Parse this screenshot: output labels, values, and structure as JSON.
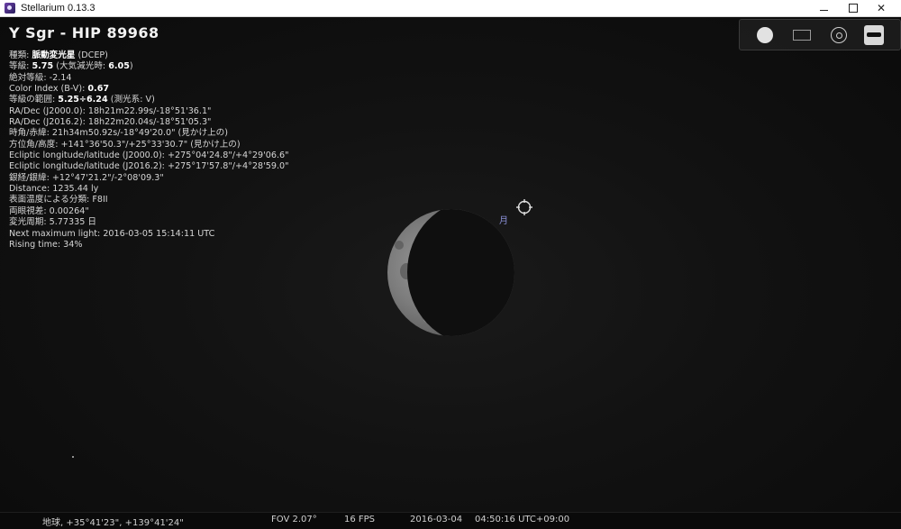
{
  "window": {
    "title": "Stellarium 0.13.3",
    "minimize_glyph": "—",
    "close_glyph": "✕"
  },
  "object": {
    "name": "Y Sgr - HIP 89968",
    "info": [
      {
        "label": "種類: ",
        "bold": "脈動変光星",
        "rest": " (DCEP)"
      },
      {
        "label": "等級: ",
        "bold": "5.75",
        "rest": " (大気減光時: ",
        "bold2": "6.05",
        "rest2": ")"
      },
      {
        "label": "絶対等級: -2.14"
      },
      {
        "label": "Color Index (B-V): ",
        "bold": "0.67"
      },
      {
        "label": "等級の範囲: ",
        "bold": "5.25÷6.24",
        "rest": " (測光系: V)"
      },
      {
        "label": "RA/Dec (J2000.0): 18h21m22.99s/-18°51'36.1\""
      },
      {
        "label": "RA/Dec (J2016.2): 18h22m20.04s/-18°51'05.3\""
      },
      {
        "label": "時角/赤緯: 21h34m50.92s/-18°49'20.0\" (見かけ上の)"
      },
      {
        "label": "方位角/高度: +141°36'50.3\"/+25°33'30.7\" (見かけ上の)"
      },
      {
        "label": "Ecliptic longitude/latitude (J2000.0): +275°04'24.8\"/+4°29'06.6\""
      },
      {
        "label": "Ecliptic longitude/latitude (J2016.2): +275°17'57.8\"/+4°28'59.0\""
      },
      {
        "label": "銀経/銀緯: +12°47'21.2\"/-2°08'09.3\""
      },
      {
        "label": "Distance: 1235.44 ly"
      },
      {
        "label": "表面温度による分類: F8II"
      },
      {
        "label": "両眼視差: 0.00264\""
      },
      {
        "label": "変光周期: 5.77335 日"
      },
      {
        "label": "Next maximum light: 2016-03-05 15:14:11 UTC"
      },
      {
        "label": "Rising time: 34%"
      }
    ]
  },
  "sky": {
    "moon_label": "月"
  },
  "status": {
    "location": "地球, +35°41'23\", +139°41'24\"",
    "fov": "FOV 2.07°",
    "fps": "16 FPS",
    "date": "2016-03-04",
    "time": "04:50:16 UTC+09:00"
  },
  "toolbar_icons": [
    "disk-icon",
    "frame-icon",
    "target-icon",
    "telescope-icon"
  ],
  "colors": {
    "moon_label": "#8a8fd6",
    "info_text": "#d6d6d6",
    "sky": "#121212"
  }
}
